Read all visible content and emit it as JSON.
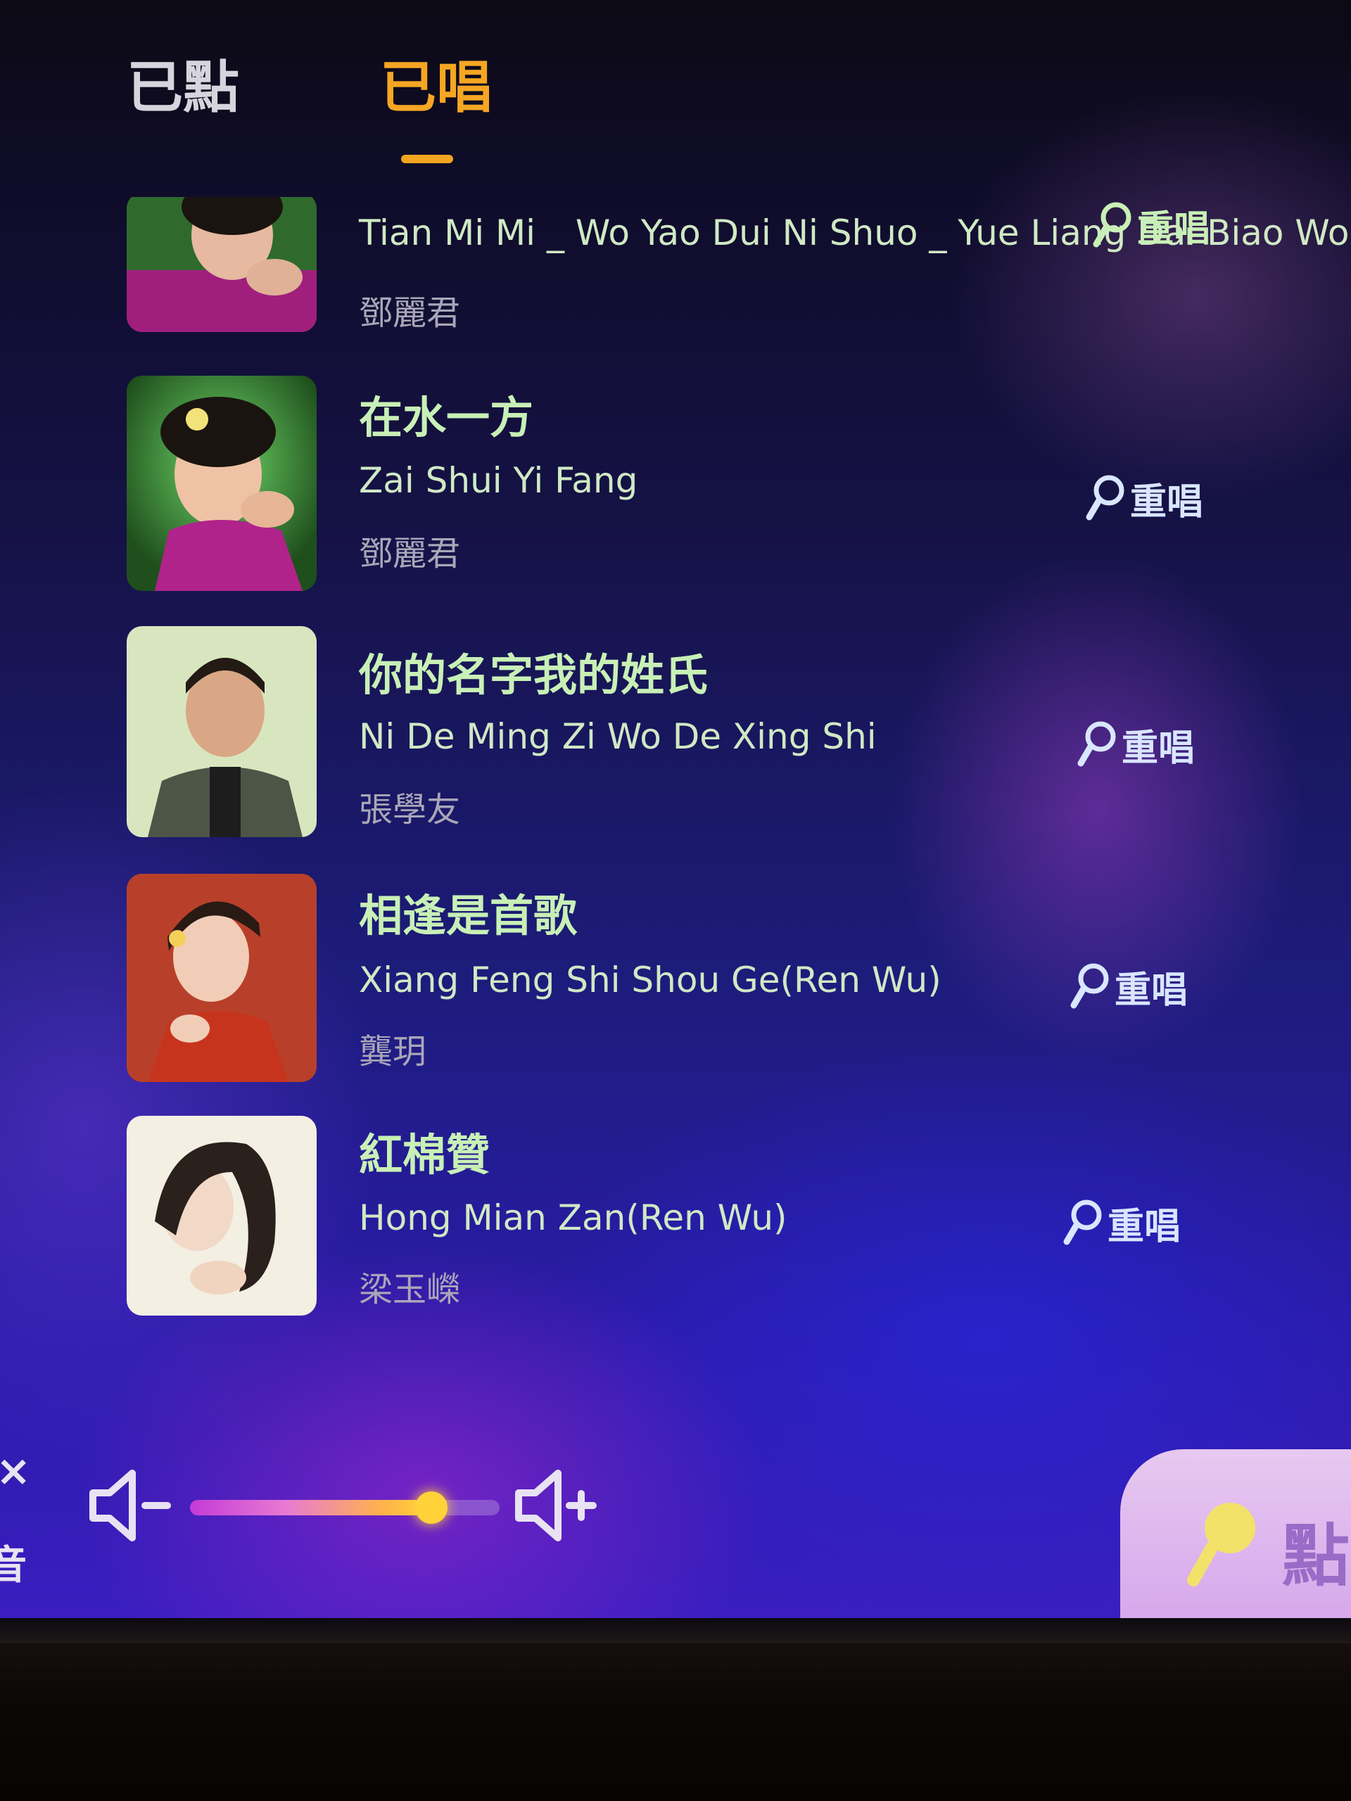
{
  "tabs": {
    "ordered": "已點",
    "sung": "已唱",
    "active": "sung"
  },
  "songs": [
    {
      "title": "",
      "pinyin": "Tian Mi Mi _ Wo Yao Dui Ni Shuo _ Yue Liang Dai Biao Wo De Xin _",
      "artist": "鄧麗君",
      "resing_label": "重唱"
    },
    {
      "title": "在水一方",
      "pinyin": "Zai Shui Yi Fang",
      "artist": "鄧麗君",
      "resing_label": "重唱"
    },
    {
      "title": "你的名字我的姓氏",
      "pinyin": "Ni De Ming Zi Wo De Xing Shi",
      "artist": "張學友",
      "resing_label": "重唱"
    },
    {
      "title": "相逢是首歌",
      "pinyin": "Xiang Feng Shi Shou Ge(Ren Wu)",
      "artist": "龔玥",
      "resing_label": "重唱"
    },
    {
      "title": "紅棉贊",
      "pinyin": "Hong Mian Zan(Ren Wu)",
      "artist": "梁玉嶸",
      "resing_label": "重唱"
    }
  ],
  "controls": {
    "mute_label": "音",
    "mute_icon": "close-x-icon",
    "volume_down_icon": "volume-down-icon",
    "volume_up_icon": "volume-up-icon",
    "volume_level": 0.78,
    "order_button_label": "點歌",
    "order_button_icon": "microphone-icon"
  },
  "colors": {
    "active_tab": "#f5a623",
    "inactive_tab": "#d6d4dc",
    "title_text": "#c8f0b6",
    "artist_text": "#a9a6b8",
    "resing_text": "#d9e6ff"
  }
}
